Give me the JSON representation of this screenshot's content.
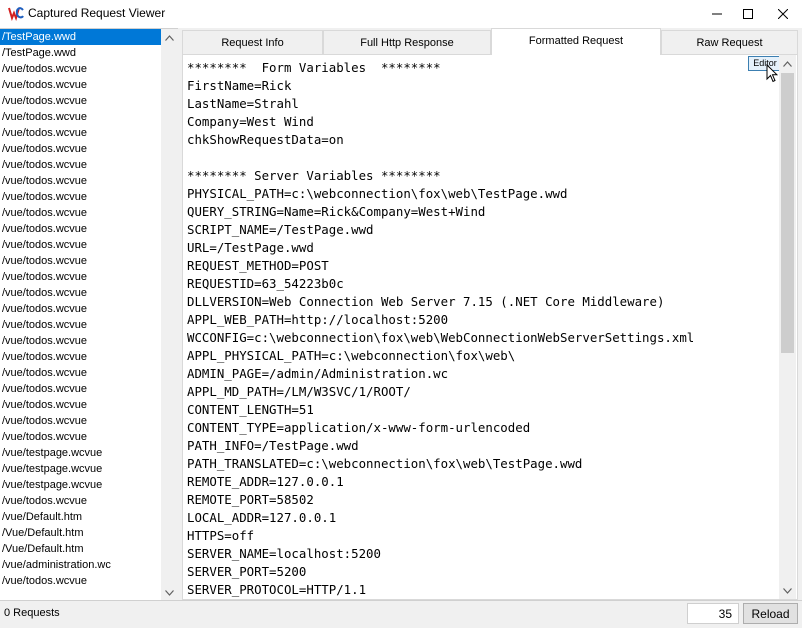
{
  "window": {
    "title": "Captured Request Viewer",
    "icon": "wc-logo-icon"
  },
  "requests": [
    {
      "path": "/TestPage.wwd",
      "selected": true
    },
    {
      "path": "/TestPage.wwd"
    },
    {
      "path": "/vue/todos.wcvue"
    },
    {
      "path": "/vue/todos.wcvue"
    },
    {
      "path": "/vue/todos.wcvue"
    },
    {
      "path": "/vue/todos.wcvue"
    },
    {
      "path": "/vue/todos.wcvue"
    },
    {
      "path": "/vue/todos.wcvue"
    },
    {
      "path": "/vue/todos.wcvue"
    },
    {
      "path": "/vue/todos.wcvue"
    },
    {
      "path": "/vue/todos.wcvue"
    },
    {
      "path": "/vue/todos.wcvue"
    },
    {
      "path": "/vue/todos.wcvue"
    },
    {
      "path": "/vue/todos.wcvue"
    },
    {
      "path": "/vue/todos.wcvue"
    },
    {
      "path": "/vue/todos.wcvue"
    },
    {
      "path": "/vue/todos.wcvue"
    },
    {
      "path": "/vue/todos.wcvue"
    },
    {
      "path": "/vue/todos.wcvue"
    },
    {
      "path": "/vue/todos.wcvue"
    },
    {
      "path": "/vue/todos.wcvue"
    },
    {
      "path": "/vue/todos.wcvue"
    },
    {
      "path": "/vue/todos.wcvue"
    },
    {
      "path": "/vue/todos.wcvue"
    },
    {
      "path": "/vue/todos.wcvue"
    },
    {
      "path": "/vue/todos.wcvue"
    },
    {
      "path": "/vue/testpage.wcvue"
    },
    {
      "path": "/vue/testpage.wcvue"
    },
    {
      "path": "/vue/testpage.wcvue"
    },
    {
      "path": "/vue/todos.wcvue"
    },
    {
      "path": "/vue/Default.htm"
    },
    {
      "path": "/Vue/Default.htm"
    },
    {
      "path": "/Vue/Default.htm"
    },
    {
      "path": "/vue/administration.wc"
    },
    {
      "path": "/vue/todos.wcvue"
    }
  ],
  "tabs": [
    {
      "label": "Request Info",
      "active": false
    },
    {
      "label": "Full Http Response",
      "active": false
    },
    {
      "label": "Formatted Request",
      "active": true
    },
    {
      "label": "Raw Request",
      "active": false
    }
  ],
  "editor_button": "Editor",
  "formatted_request": [
    "********  Form Variables  ********",
    "FirstName=Rick",
    "LastName=Strahl",
    "Company=West Wind",
    "chkShowRequestData=on",
    "",
    "******** Server Variables ********",
    "PHYSICAL_PATH=c:\\webconnection\\fox\\web\\TestPage.wwd",
    "QUERY_STRING=Name=Rick&Company=West+Wind",
    "SCRIPT_NAME=/TestPage.wwd",
    "URL=/TestPage.wwd",
    "REQUEST_METHOD=POST",
    "REQUESTID=63_54223b0c",
    "DLLVERSION=Web Connection Web Server 7.15 (.NET Core Middleware)",
    "APPL_WEB_PATH=http://localhost:5200",
    "WCCONFIG=c:\\webconnection\\fox\\web\\WebConnectionWebServerSettings.xml",
    "APPL_PHYSICAL_PATH=c:\\webconnection\\fox\\web\\",
    "ADMIN_PAGE=/admin/Administration.wc",
    "APPL_MD_PATH=/LM/W3SVC/1/ROOT/",
    "CONTENT_LENGTH=51",
    "CONTENT_TYPE=application/x-www-form-urlencoded",
    "PATH_INFO=/TestPage.wwd",
    "PATH_TRANSLATED=c:\\webconnection\\fox\\web\\TestPage.wwd",
    "REMOTE_ADDR=127.0.0.1",
    "REMOTE_PORT=58502",
    "LOCAL_ADDR=127.0.0.1",
    "HTTPS=off",
    "SERVER_NAME=localhost:5200",
    "SERVER_PORT=5200",
    "SERVER_PROTOCOL=HTTP/1.1"
  ],
  "status": {
    "requests_label": "0 Requests",
    "count": "35",
    "reload_label": "Reload"
  },
  "colors": {
    "selection": "#0078d7",
    "logo_red": "#d42020",
    "logo_blue": "#1f5fbf"
  }
}
